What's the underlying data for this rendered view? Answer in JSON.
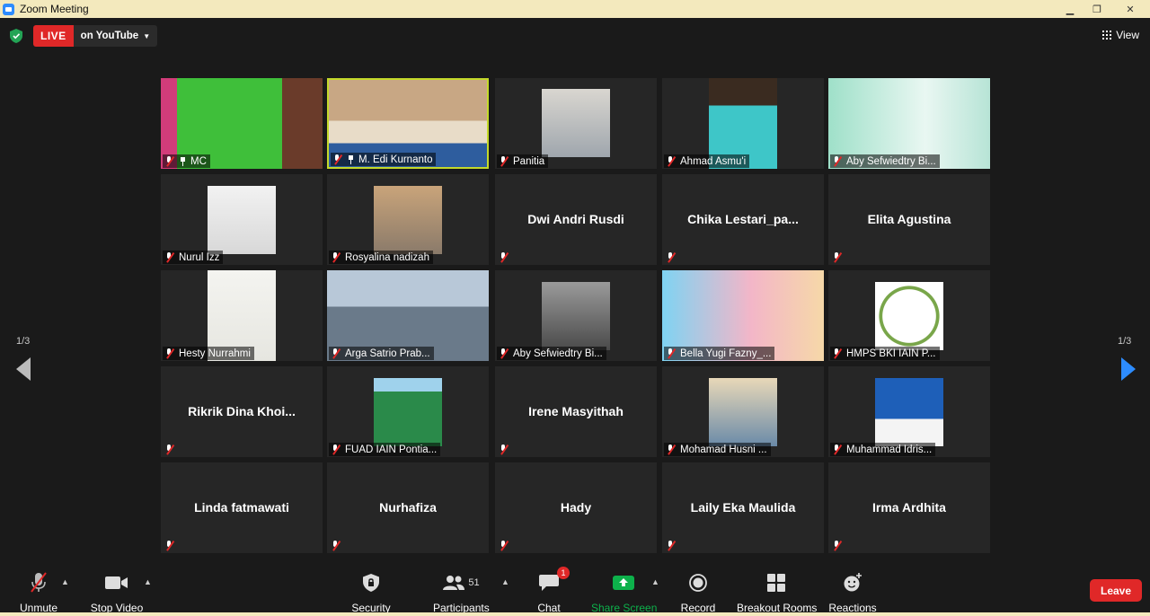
{
  "window": {
    "title": "Zoom Meeting"
  },
  "topbar": {
    "live_label": "LIVE",
    "stream_label": "on YouTube",
    "view_label": "View"
  },
  "pagination": {
    "left": "1/3",
    "right": "1/3"
  },
  "tiles": [
    {
      "name": "MC",
      "video": true,
      "pinned": true
    },
    {
      "name": "M. Edi Kurnanto",
      "video": true,
      "pinned": true,
      "active": true
    },
    {
      "name": "Panitia",
      "video": true
    },
    {
      "name": "Ahmad Asmu'i",
      "video": true
    },
    {
      "name": "Aby Sefwiedtry Bi...",
      "video": true
    },
    {
      "name": "Nurul Izz",
      "video": true
    },
    {
      "name": "Rosyalina nadizah",
      "video": true
    },
    {
      "name": "Dwi Andri Rusdi",
      "video": false
    },
    {
      "name": "Chika  Lestari_pa...",
      "video": false
    },
    {
      "name": "Elita Agustina",
      "video": false
    },
    {
      "name": "Hesty Nurrahmi",
      "video": true
    },
    {
      "name": "Arga Satrio Prab...",
      "video": true
    },
    {
      "name": "Aby Sefwiedtry Bi...",
      "video": true
    },
    {
      "name": "Bella Yugi Fazny_...",
      "video": true
    },
    {
      "name": "HMPS BKI IAIN P...",
      "video": true
    },
    {
      "name": "Rikrik  Dina  Khoi...",
      "video": false
    },
    {
      "name": "FUAD IAIN Pontia...",
      "video": true
    },
    {
      "name": "Irene Masyithah",
      "video": false
    },
    {
      "name": "Mohamad Husni ...",
      "video": true
    },
    {
      "name": "Muhammad Idris...",
      "video": true
    },
    {
      "name": "Linda fatmawati",
      "video": false
    },
    {
      "name": "Nurhafiza",
      "video": false
    },
    {
      "name": "Hady",
      "video": false
    },
    {
      "name": "Laily Eka Maulida",
      "video": false
    },
    {
      "name": "Irma Ardhita",
      "video": false
    }
  ],
  "toolbar": {
    "unmute": "Unmute",
    "stop_video": "Stop Video",
    "security": "Security",
    "participants": "Participants",
    "participants_count": "51",
    "chat": "Chat",
    "chat_badge": "1",
    "share_screen": "Share Screen",
    "record": "Record",
    "breakout": "Breakout Rooms",
    "reactions": "Reactions",
    "leave": "Leave"
  },
  "colors": {
    "live": "#e02828",
    "share": "#0db14b",
    "active_border": "#c4d92a",
    "next_arrow": "#2d8cff"
  }
}
